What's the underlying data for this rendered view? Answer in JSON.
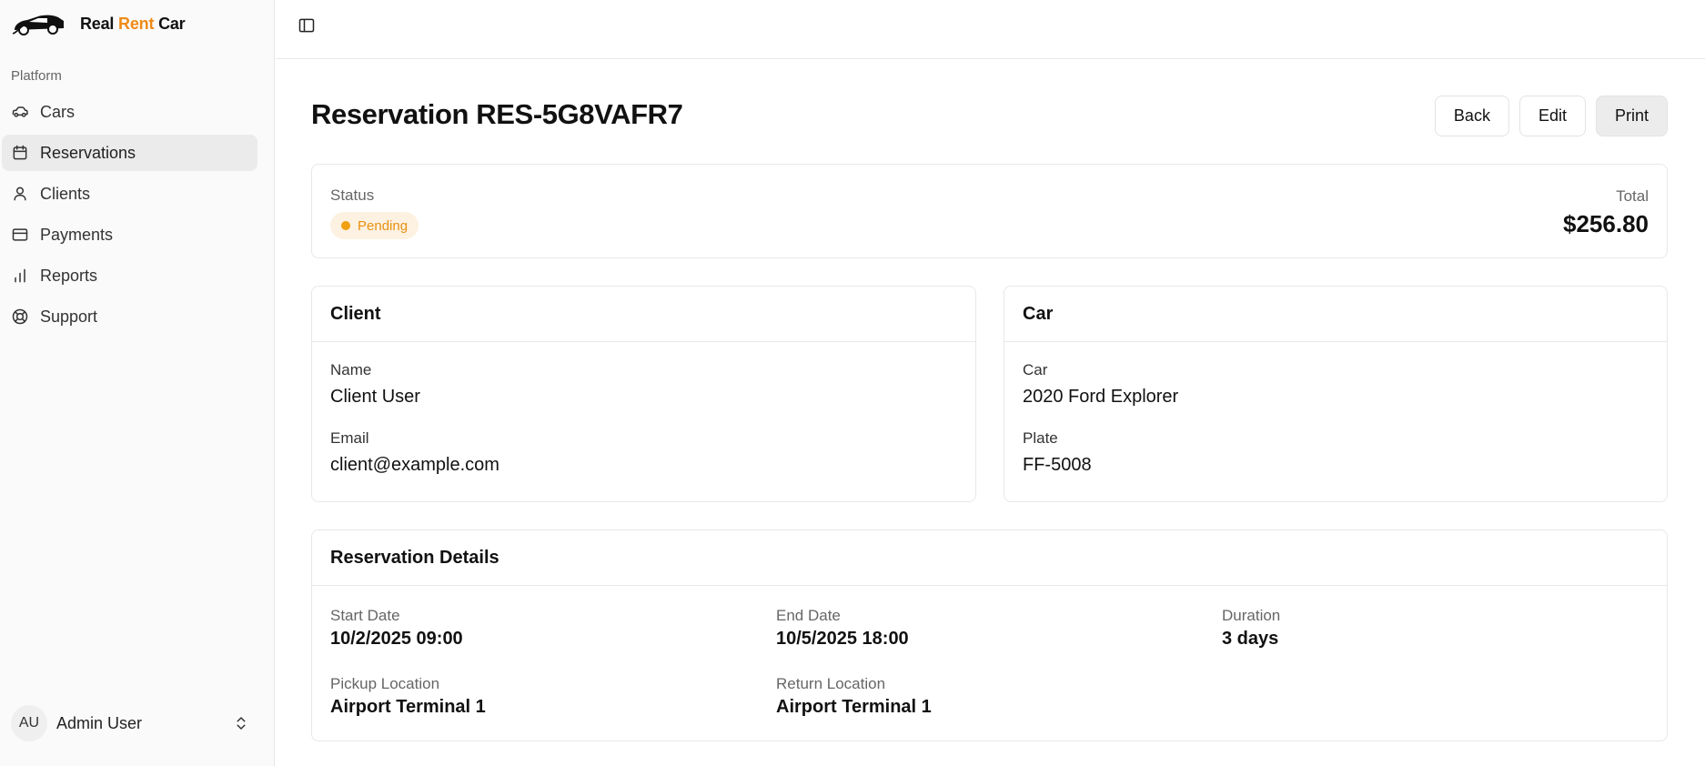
{
  "brand": {
    "part1": "Real",
    "part2": "Rent",
    "part3": "Car"
  },
  "sidebar": {
    "section_label": "Platform",
    "items": [
      {
        "label": "Cars",
        "icon": "car-icon"
      },
      {
        "label": "Reservations",
        "icon": "calendar-icon",
        "active": true
      },
      {
        "label": "Clients",
        "icon": "user-icon"
      },
      {
        "label": "Payments",
        "icon": "credit-card-icon"
      },
      {
        "label": "Reports",
        "icon": "bar-chart-icon"
      },
      {
        "label": "Support",
        "icon": "life-buoy-icon"
      }
    ],
    "user": {
      "initials": "AU",
      "name": "Admin User"
    }
  },
  "page": {
    "title": "Reservation RES-5G8VAFR7",
    "actions": {
      "back": "Back",
      "edit": "Edit",
      "print": "Print"
    }
  },
  "status": {
    "label": "Status",
    "value": "Pending",
    "color": "#f0a010",
    "total_label": "Total",
    "total_value": "$256.80"
  },
  "client": {
    "heading": "Client",
    "name_label": "Name",
    "name_value": "Client User",
    "email_label": "Email",
    "email_value": "client@example.com"
  },
  "car": {
    "heading": "Car",
    "car_label": "Car",
    "car_value": "2020 Ford Explorer",
    "plate_label": "Plate",
    "plate_value": "FF-5008"
  },
  "details": {
    "heading": "Reservation Details",
    "start_label": "Start Date",
    "start_value": "10/2/2025 09:00",
    "end_label": "End Date",
    "end_value": "10/5/2025 18:00",
    "duration_label": "Duration",
    "duration_value": "3 days",
    "pickup_label": "Pickup Location",
    "pickup_value": "Airport Terminal 1",
    "return_label": "Return Location",
    "return_value": "Airport Terminal 1"
  },
  "colors": {
    "accent": "#f08a17",
    "active_bg": "#ebebeb"
  }
}
